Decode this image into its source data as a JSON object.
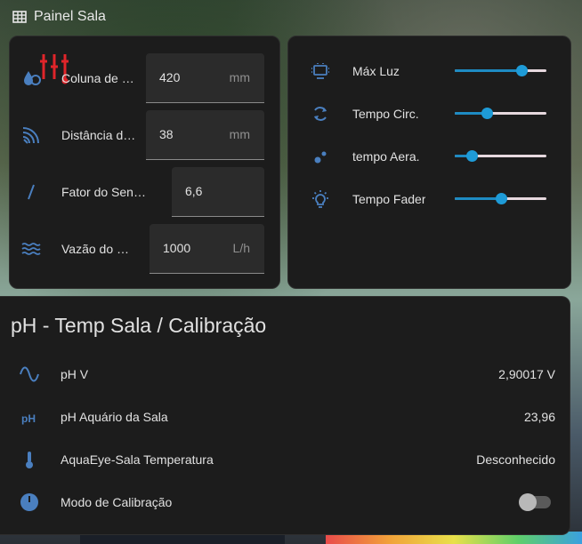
{
  "header": {
    "title": "Painel Sala",
    "icon": "table-icon"
  },
  "inputs_card": {
    "rows": [
      {
        "icon": "water-drop-icon",
        "label": "Coluna de Água",
        "value": "420",
        "unit": "mm"
      },
      {
        "icon": "wifi-sensor-icon",
        "label": "Distância do Sensor",
        "value": "38",
        "unit": "mm"
      },
      {
        "icon": "slash-icon",
        "label": "Fator do Sensor",
        "value": "6,6",
        "unit": ""
      },
      {
        "icon": "waves-icon",
        "label": "Vazão do Fluxo",
        "value": "1000",
        "unit": "L/h"
      }
    ]
  },
  "sliders_card": {
    "rows": [
      {
        "icon": "led-panel-icon",
        "label": "Máx Luz",
        "level": 0.73
      },
      {
        "icon": "refresh-icon",
        "label": "Tempo Circ.",
        "level": 0.35
      },
      {
        "icon": "bubbles-icon",
        "label": "tempo Aera.",
        "level": 0.18
      },
      {
        "icon": "lightbulb-icon",
        "label": "Tempo Fader",
        "level": 0.5
      }
    ]
  },
  "ph_card": {
    "title": "pH - Temp Sala / Calibração",
    "rows": [
      {
        "icon": "sine-wave-icon",
        "label": "pH V",
        "value": "2,90017 V"
      },
      {
        "icon": "ph-icon",
        "label": "pH Aquário da Sala",
        "value": "23,96"
      },
      {
        "icon": "thermometer-icon",
        "label": "AquaEye-Sala Temperatura",
        "value": "Desconhecido"
      },
      {
        "icon": "gauge-icon",
        "label": "Modo de Calibração",
        "toggle": false
      }
    ]
  },
  "colors": {
    "accent": "#1e9bd7",
    "icon": "#4a7fbf",
    "card": "#1c1c1c"
  }
}
